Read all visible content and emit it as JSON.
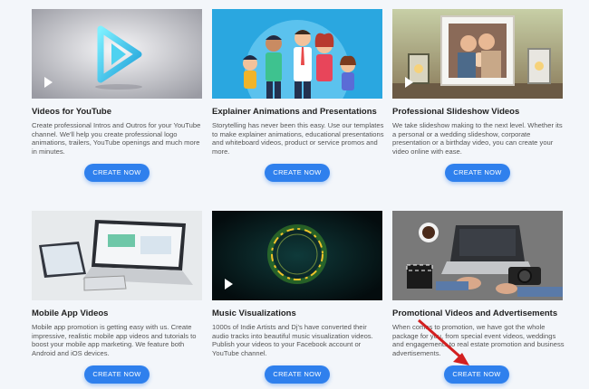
{
  "cards": [
    {
      "title": "Videos for YouTube",
      "description": "Create professional Intros and Outros for your YouTube channel. We'll help you create professional logo animations, trailers, YouTube openings and much more in minutes.",
      "button": "CREATE NOW",
      "thumbnail": "youtube-logo-thumbnail"
    },
    {
      "title": "Explainer Animations and Presentations",
      "description": "Storytelling has never been this easy. Use our templates to make explainer animations, educational presentations and whiteboard videos, product or service promos and more.",
      "button": "CREATE NOW",
      "thumbnail": "family-cartoon-thumbnail"
    },
    {
      "title": "Professional Slideshow Videos",
      "description": "We take slideshow making to the next level. Whether its a personal or a wedding slideshow, corporate presentation or a birthday video, you can create your video online with ease.",
      "button": "CREATE NOW",
      "thumbnail": "photo-frame-thumbnail"
    },
    {
      "title": "Mobile App Videos",
      "description": "Mobile app promotion is getting easy with us. Create impressive, realistic mobile app videos and tutorials to boost your mobile app marketing. We feature both Android and iOS devices.",
      "button": "CREATE NOW",
      "thumbnail": "devices-thumbnail"
    },
    {
      "title": "Music Visualizations",
      "description": "1000s of Indie Artists and Dj's have converted their audio tracks into beautiful music visualization videos. Publish your videos to your Facebook account or YouTube channel.",
      "button": "CREATE NOW",
      "thumbnail": "glow-ring-thumbnail"
    },
    {
      "title": "Promotional Videos and Advertisements",
      "description": "When comes to promotion, we have got the whole package for you, from special event videos, weddings and engagements to real estate promotion and business advertisements.",
      "button": "CREATE NOW",
      "thumbnail": "workspace-thumbnail"
    }
  ],
  "colors": {
    "button": "#2f80ed",
    "annotation_arrow": "#d32020",
    "page_background": "#f3f6fa"
  },
  "icons": {
    "play": "play-icon",
    "annotation": "red-arrow-annotation"
  }
}
